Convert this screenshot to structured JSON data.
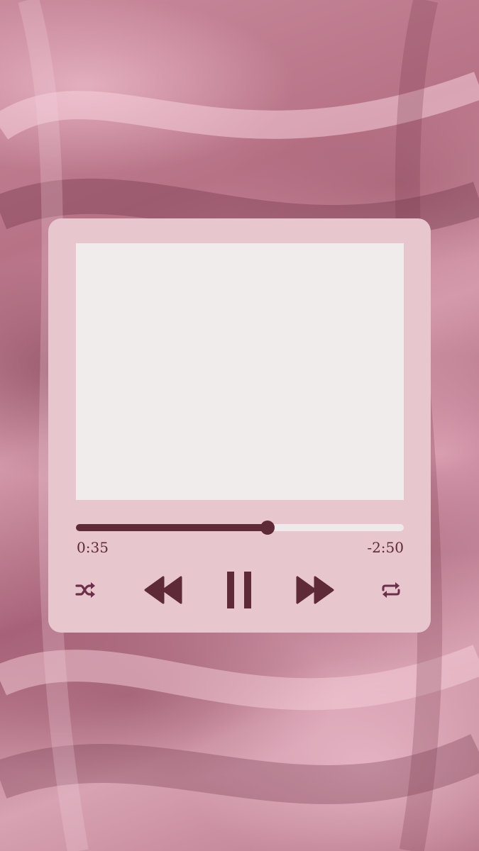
{
  "player": {
    "elapsed_time": "0:35",
    "remaining_time": "-2:50",
    "progress_fraction": 0.585
  },
  "controls": {
    "shuffle_icon": "shuffle-icon",
    "rewind_icon": "rewind-icon",
    "pause_icon": "pause-icon",
    "fast_forward_icon": "fast-forward-icon",
    "repeat_icon": "repeat-icon"
  },
  "colors": {
    "card": "#e8c6ce",
    "artwork": "#f0ecec",
    "accent": "#5e2a37",
    "track": "#f0e9eb"
  }
}
